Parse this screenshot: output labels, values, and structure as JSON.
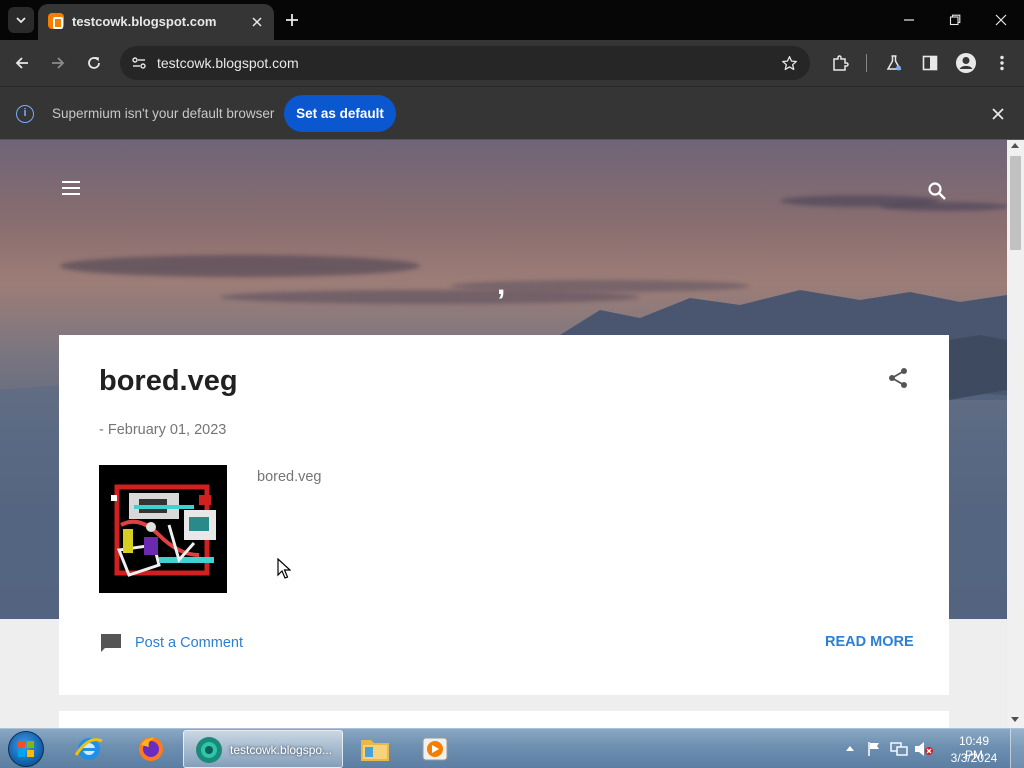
{
  "browser": {
    "tab_title": "testcowk.blogspot.com",
    "url": "testcowk.blogspot.com"
  },
  "infobar": {
    "message": "Supermium isn't your default browser",
    "button_label": "Set as default"
  },
  "blog": {
    "title": ","
  },
  "post": {
    "title": "bored.veg",
    "date": "- February 01, 2023",
    "snippet": "bored.veg",
    "comment_link": "Post a Comment",
    "read_more": "READ MORE"
  },
  "taskbar": {
    "active_window_label": "testcowk.blogspo...",
    "clock_time": "10:49 PM",
    "clock_date": "3/3/2024"
  },
  "colors": {
    "accent_blue": "#0b57d0",
    "link_blue": "#2a7fd6",
    "chrome_dark": "#353535",
    "favicon_orange": "#f57d00"
  }
}
